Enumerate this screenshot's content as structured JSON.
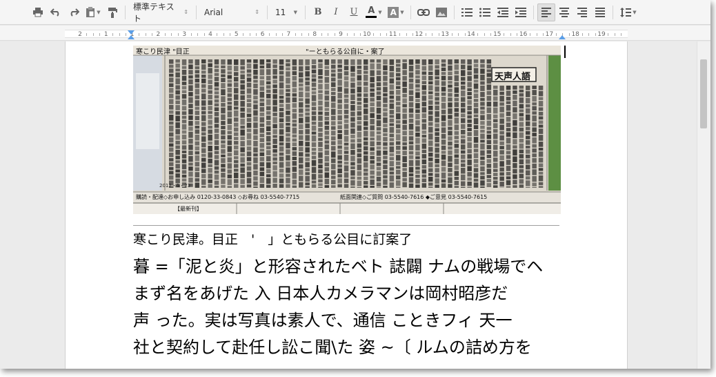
{
  "toolbar": {
    "style_select": "標準テキスト",
    "font_select": "Arial",
    "size_select": "11",
    "bold_label": "B",
    "italic_label": "I",
    "underline_label": "U",
    "text_color_label": "A",
    "highlight_label": "A"
  },
  "ruler": {
    "numbers": [
      "2",
      "1",
      "1",
      "2",
      "3",
      "4",
      "5",
      "6",
      "7",
      "8",
      "9",
      "10",
      "11",
      "12",
      "13",
      "14",
      "15",
      "16",
      "17",
      "18",
      "19"
    ]
  },
  "photo": {
    "header_left": "寒こり民津 \"目正",
    "header_right": "\"ーともらる公自に・案了",
    "column_title": "天声人語",
    "footer_left": "購読・配達◇お申し込み 0120-33-0843 ◇お尋ね 03-5540-7715",
    "footer_mid": "紙面関連◇ご質問 03-5540-7616 ◆ご意見 03-5540-7615",
    "date_stamp": "2012・1・23",
    "latest": "【最新刊】"
  },
  "document": {
    "line1": "寒こり民津。目正　'　」ともらる公目に訂案了",
    "line2": "暮 =「泥と炎」と形容されたベト 誌闢 ナムの戦場でヘ",
    "line3": "まず名をあげた 入 日本人カメラマンは岡村昭彦だ",
    "line4": "声 った。実は写真は素人で、通信 こときフィ 天一",
    "line5": "社と契約して赴任し訟こ聞\\た 姿 ~〔 ルムの詰め方を"
  },
  "colors": {
    "accent": "#5a9ee8",
    "text_color_bar": "#000000"
  }
}
